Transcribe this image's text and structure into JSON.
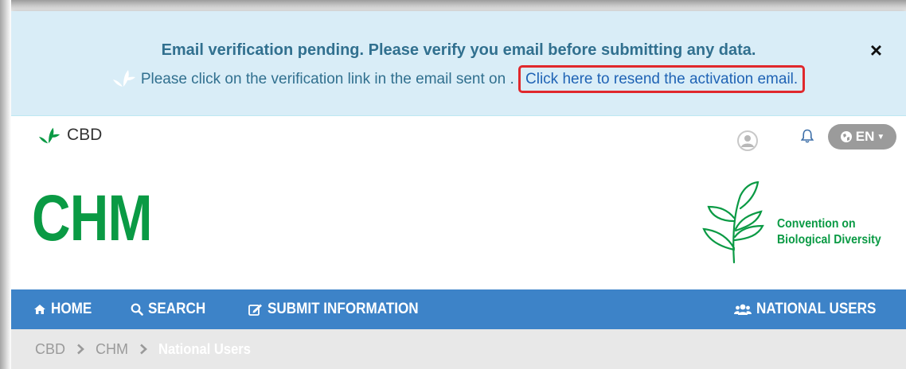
{
  "alert": {
    "title": "Email verification pending. Please verify you email before submitting any data.",
    "message": "Please click on the verification link in the email sent on .",
    "resend_link": "Click here to resend the activation email.",
    "close_symbol": "×"
  },
  "topbar": {
    "cbd_label": "CBD",
    "language": "EN",
    "icons": [
      "cbd-leaf-icon",
      "user-avatar-icon",
      "bell-icon",
      "globe-icon",
      "caret-down-icon"
    ]
  },
  "header": {
    "title": "CHM",
    "org_line1": "Convention on",
    "org_line2": "Biological Diversity"
  },
  "nav": {
    "home": "HOME",
    "search": "SEARCH",
    "submit": "SUBMIT INFORMATION",
    "national_users": "NATIONAL USERS"
  },
  "breadcrumb": {
    "items": [
      "CBD",
      "CHM",
      "National Users"
    ]
  },
  "colors": {
    "alert_bg": "#d9edf7",
    "alert_text": "#31708f",
    "brand_green": "#0a9a44",
    "nav_blue": "#3d83c8",
    "highlight_red": "#e0282c"
  }
}
